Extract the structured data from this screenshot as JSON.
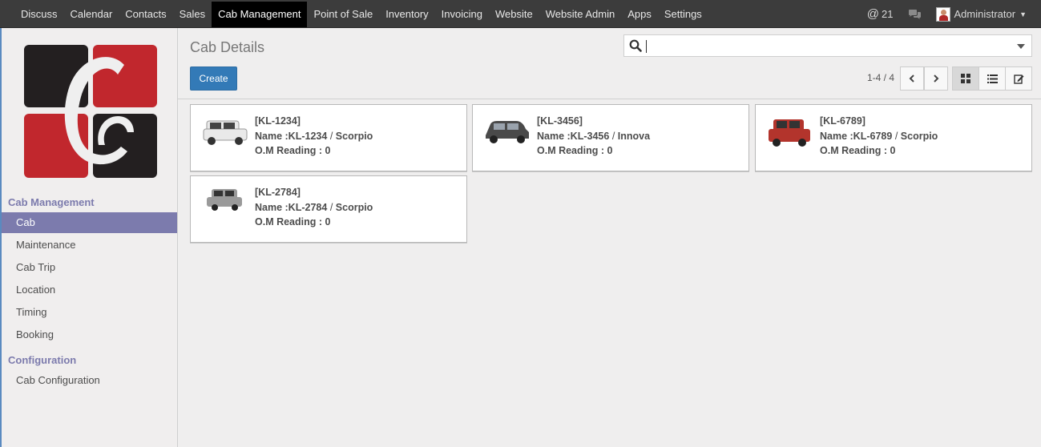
{
  "topbar": {
    "menu": [
      "Discuss",
      "Calendar",
      "Contacts",
      "Sales",
      "Cab Management",
      "Point of Sale",
      "Inventory",
      "Invoicing",
      "Website",
      "Website Admin",
      "Apps",
      "Settings"
    ],
    "active_index": 4,
    "mentions_count": "21",
    "user_name": "Administrator"
  },
  "sidebar": {
    "section1": "Cab Management",
    "items1": [
      "Cab",
      "Maintenance",
      "Cab Trip",
      "Location",
      "Timing",
      "Booking"
    ],
    "active_item": "Cab",
    "section2": "Configuration",
    "items2": [
      "Cab Configuration"
    ]
  },
  "control_panel": {
    "title": "Cab Details",
    "search_value": "",
    "create_label": "Create",
    "pager": "1-4 / 4"
  },
  "cards": [
    {
      "ref": "[KL-1234]",
      "name": "Name :KL-1234",
      "model": "Scorpio",
      "reading": "O.M Reading : 0",
      "car_color": "#e9e9e9"
    },
    {
      "ref": "[KL-3456]",
      "name": "Name :KL-3456",
      "model": "Innova",
      "reading": "O.M Reading : 0",
      "car_color": "#4a4a4a"
    },
    {
      "ref": "[KL-6789]",
      "name": "Name :KL-6789",
      "model": "Scorpio",
      "reading": "O.M Reading : 0",
      "car_color": "#b3342c"
    },
    {
      "ref": "[KL-2784]",
      "name": "Name :KL-2784",
      "model": "Scorpio",
      "reading": "O.M Reading : 0",
      "car_color": "#9a9a9a"
    }
  ],
  "colors": {
    "accent": "#7c7bad",
    "primary": "#337ab7",
    "navbar": "#3c3c3c"
  },
  "icons": {
    "search": "search-icon",
    "dropdown": "caret-down-icon",
    "prev": "chevron-left-icon",
    "next": "chevron-right-icon",
    "kanban": "grid-icon",
    "list": "list-icon",
    "form": "edit-icon",
    "mentions": "at-icon",
    "chat": "chat-bubble-icon"
  }
}
